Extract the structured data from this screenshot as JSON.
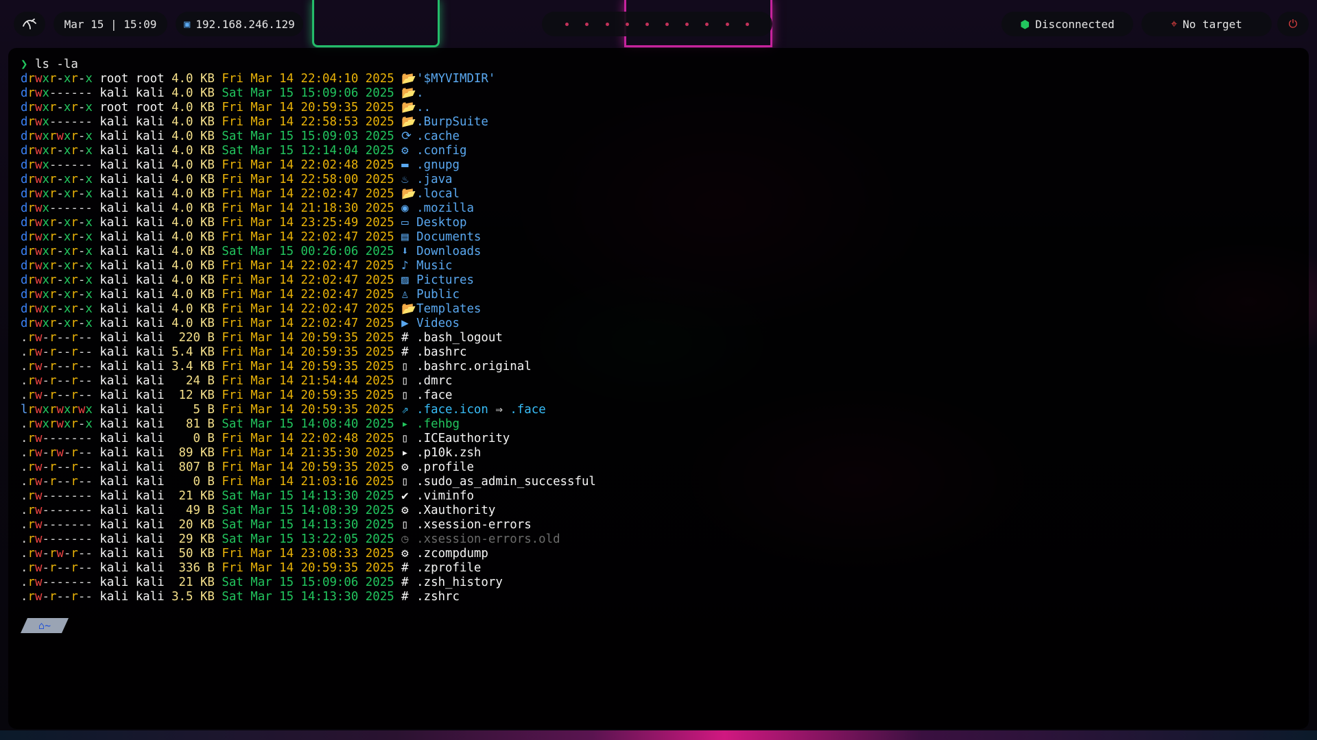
{
  "topbar": {
    "logo_icon": "kali-dragon-icon",
    "clock": "Mar 15 | 15:09",
    "ip": "192.168.246.129",
    "vpn_status": "Disconnected",
    "target": "No target"
  },
  "terminal": {
    "command_prompt": "❯",
    "command": "ls -la",
    "home_chip": "~",
    "rows": [
      {
        "perm": "drwxr-xr-x",
        "owner": "root",
        "group": "root",
        "size": "4.0 KB",
        "date": "Fri Mar 14 22:04:10 2025",
        "name": "'$MYVIMDIR'",
        "icon": "folder-open-icon",
        "kind": "dir"
      },
      {
        "perm": "drwx------",
        "owner": "kali",
        "group": "kali",
        "size": "4.0 KB",
        "date": "Sat Mar 15 15:09:06 2025",
        "name": ".",
        "icon": "folder-open-icon",
        "kind": "dir"
      },
      {
        "perm": "drwxr-xr-x",
        "owner": "root",
        "group": "root",
        "size": "4.0 KB",
        "date": "Fri Mar 14 20:59:35 2025",
        "name": "..",
        "icon": "folder-open-icon",
        "kind": "dir"
      },
      {
        "perm": "drwx------",
        "owner": "kali",
        "group": "kali",
        "size": "4.0 KB",
        "date": "Fri Mar 14 22:58:53 2025",
        "name": ".BurpSuite",
        "icon": "folder-open-icon",
        "kind": "dir"
      },
      {
        "perm": "drwxrwxr-x",
        "owner": "kali",
        "group": "kali",
        "size": "4.0 KB",
        "date": "Sat Mar 15 15:09:03 2025",
        "name": ".cache",
        "icon": "cache-icon",
        "kind": "dir"
      },
      {
        "perm": "drwxr-xr-x",
        "owner": "kali",
        "group": "kali",
        "size": "4.0 KB",
        "date": "Sat Mar 15 12:14:04 2025",
        "name": ".config",
        "icon": "config-folder-icon",
        "kind": "dir"
      },
      {
        "perm": "drwx------",
        "owner": "kali",
        "group": "kali",
        "size": "4.0 KB",
        "date": "Fri Mar 14 22:02:48 2025",
        "name": ".gnupg",
        "icon": "folder-icon",
        "kind": "dir"
      },
      {
        "perm": "drwxr-xr-x",
        "owner": "kali",
        "group": "kali",
        "size": "4.0 KB",
        "date": "Fri Mar 14 22:58:00 2025",
        "name": ".java",
        "icon": "java-icon",
        "kind": "dir"
      },
      {
        "perm": "drwxr-xr-x",
        "owner": "kali",
        "group": "kali",
        "size": "4.0 KB",
        "date": "Fri Mar 14 22:02:47 2025",
        "name": ".local",
        "icon": "folder-open-icon",
        "kind": "dir"
      },
      {
        "perm": "drwx------",
        "owner": "kali",
        "group": "kali",
        "size": "4.0 KB",
        "date": "Fri Mar 14 21:18:30 2025",
        "name": ".mozilla",
        "icon": "firefox-icon",
        "kind": "dir"
      },
      {
        "perm": "drwxr-xr-x",
        "owner": "kali",
        "group": "kali",
        "size": "4.0 KB",
        "date": "Fri Mar 14 23:25:49 2025",
        "name": "Desktop",
        "icon": "desktop-icon",
        "kind": "dir"
      },
      {
        "perm": "drwxr-xr-x",
        "owner": "kali",
        "group": "kali",
        "size": "4.0 KB",
        "date": "Fri Mar 14 22:02:47 2025",
        "name": "Documents",
        "icon": "documents-icon",
        "kind": "dir"
      },
      {
        "perm": "drwxr-xr-x",
        "owner": "kali",
        "group": "kali",
        "size": "4.0 KB",
        "date": "Sat Mar 15 00:26:06 2025",
        "name": "Downloads",
        "icon": "downloads-icon",
        "kind": "dir"
      },
      {
        "perm": "drwxr-xr-x",
        "owner": "kali",
        "group": "kali",
        "size": "4.0 KB",
        "date": "Fri Mar 14 22:02:47 2025",
        "name": "Music",
        "icon": "music-folder-icon",
        "kind": "dir"
      },
      {
        "perm": "drwxr-xr-x",
        "owner": "kali",
        "group": "kali",
        "size": "4.0 KB",
        "date": "Fri Mar 14 22:02:47 2025",
        "name": "Pictures",
        "icon": "pictures-folder-icon",
        "kind": "dir"
      },
      {
        "perm": "drwxr-xr-x",
        "owner": "kali",
        "group": "kali",
        "size": "4.0 KB",
        "date": "Fri Mar 14 22:02:47 2025",
        "name": "Public",
        "icon": "user-icon",
        "kind": "dir"
      },
      {
        "perm": "drwxr-xr-x",
        "owner": "kali",
        "group": "kali",
        "size": "4.0 KB",
        "date": "Fri Mar 14 22:02:47 2025",
        "name": "Templates",
        "icon": "folder-open-icon",
        "kind": "dir"
      },
      {
        "perm": "drwxr-xr-x",
        "owner": "kali",
        "group": "kali",
        "size": "4.0 KB",
        "date": "Fri Mar 14 22:02:47 2025",
        "name": "Videos",
        "icon": "video-icon",
        "kind": "dir"
      },
      {
        "perm": ".rw-r--r--",
        "owner": "kali",
        "group": "kali",
        "size": "220 B",
        "date": "Fri Mar 14 20:59:35 2025",
        "name": ".bash_logout",
        "icon": "shell-icon",
        "kind": "file"
      },
      {
        "perm": ".rw-r--r--",
        "owner": "kali",
        "group": "kali",
        "size": "5.4 KB",
        "date": "Fri Mar 14 20:59:35 2025",
        "name": ".bashrc",
        "icon": "shell-icon",
        "kind": "file"
      },
      {
        "perm": ".rw-r--r--",
        "owner": "kali",
        "group": "kali",
        "size": "3.4 KB",
        "date": "Fri Mar 14 20:59:35 2025",
        "name": ".bashrc.original",
        "icon": "file-icon",
        "kind": "file"
      },
      {
        "perm": ".rw-r--r--",
        "owner": "kali",
        "group": "kali",
        "size": "24 B",
        "date": "Fri Mar 14 21:54:44 2025",
        "name": ".dmrc",
        "icon": "file-icon",
        "kind": "file"
      },
      {
        "perm": ".rw-r--r--",
        "owner": "kali",
        "group": "kali",
        "size": "12 KB",
        "date": "Fri Mar 14 20:59:35 2025",
        "name": ".face",
        "icon": "file-icon",
        "kind": "file"
      },
      {
        "perm": "lrwxrwxrwx",
        "owner": "kali",
        "group": "kali",
        "size": "5 B",
        "date": "Fri Mar 14 20:59:35 2025",
        "name": ".face.icon",
        "icon": "symlink-icon",
        "kind": "link",
        "link_arrow": "⇒",
        "link_target": ".face"
      },
      {
        "perm": ".rwxrwxr-x",
        "owner": "kali",
        "group": "kali",
        "size": "81 B",
        "date": "Sat Mar 15 14:08:40 2025",
        "name": ".fehbg",
        "icon": "terminal-icon",
        "kind": "exec"
      },
      {
        "perm": ".rw-------",
        "owner": "kali",
        "group": "kali",
        "size": "0 B",
        "date": "Fri Mar 14 22:02:48 2025",
        "name": ".ICEauthority",
        "icon": "file-icon",
        "kind": "file"
      },
      {
        "perm": ".rw-rw-r--",
        "owner": "kali",
        "group": "kali",
        "size": "89 KB",
        "date": "Fri Mar 14 21:35:30 2025",
        "name": ".p10k.zsh",
        "icon": "terminal-icon",
        "kind": "file"
      },
      {
        "perm": ".rw-r--r--",
        "owner": "kali",
        "group": "kali",
        "size": "807 B",
        "date": "Fri Mar 14 20:59:35 2025",
        "name": ".profile",
        "icon": "gear-icon",
        "kind": "file"
      },
      {
        "perm": ".rw-r--r--",
        "owner": "kali",
        "group": "kali",
        "size": "0 B",
        "date": "Fri Mar 14 21:03:16 2025",
        "name": ".sudo_as_admin_successful",
        "icon": "file-icon",
        "kind": "file"
      },
      {
        "perm": ".rw-------",
        "owner": "kali",
        "group": "kali",
        "size": "21 KB",
        "date": "Sat Mar 15 14:13:30 2025",
        "name": ".viminfo",
        "icon": "vim-icon",
        "kind": "file"
      },
      {
        "perm": ".rw-------",
        "owner": "kali",
        "group": "kali",
        "size": "49 B",
        "date": "Sat Mar 15 14:08:39 2025",
        "name": ".Xauthority",
        "icon": "gear-icon",
        "kind": "file"
      },
      {
        "perm": ".rw-------",
        "owner": "kali",
        "group": "kali",
        "size": "20 KB",
        "date": "Sat Mar 15 14:13:30 2025",
        "name": ".xsession-errors",
        "icon": "file-icon",
        "kind": "file"
      },
      {
        "perm": ".rw-------",
        "owner": "kali",
        "group": "kali",
        "size": "29 KB",
        "date": "Sat Mar 15 13:22:05 2025",
        "name": ".xsession-errors.old",
        "icon": "history-icon",
        "kind": "dim"
      },
      {
        "perm": ".rw-rw-r--",
        "owner": "kali",
        "group": "kali",
        "size": "50 KB",
        "date": "Fri Mar 14 23:08:33 2025",
        "name": ".zcompdump",
        "icon": "gear-icon",
        "kind": "file"
      },
      {
        "perm": ".rw-r--r--",
        "owner": "kali",
        "group": "kali",
        "size": "336 B",
        "date": "Fri Mar 14 20:59:35 2025",
        "name": ".zprofile",
        "icon": "shell-icon",
        "kind": "file"
      },
      {
        "perm": ".rw-------",
        "owner": "kali",
        "group": "kali",
        "size": "21 KB",
        "date": "Sat Mar 15 15:09:06 2025",
        "name": ".zsh_history",
        "icon": "shell-icon",
        "kind": "file"
      },
      {
        "perm": ".rw-r--r--",
        "owner": "kali",
        "group": "kali",
        "size": "3.5 KB",
        "date": "Sat Mar 15 14:13:30 2025",
        "name": ".zshrc",
        "icon": "shell-icon",
        "kind": "file"
      }
    ]
  },
  "colors": {
    "accent_blue": "#5aa8f0",
    "perm_read": "#eab308",
    "perm_write": "#ef4444",
    "perm_exec": "#22c55e",
    "status_ok": "#22c55e",
    "status_bad": "#ef4444"
  }
}
